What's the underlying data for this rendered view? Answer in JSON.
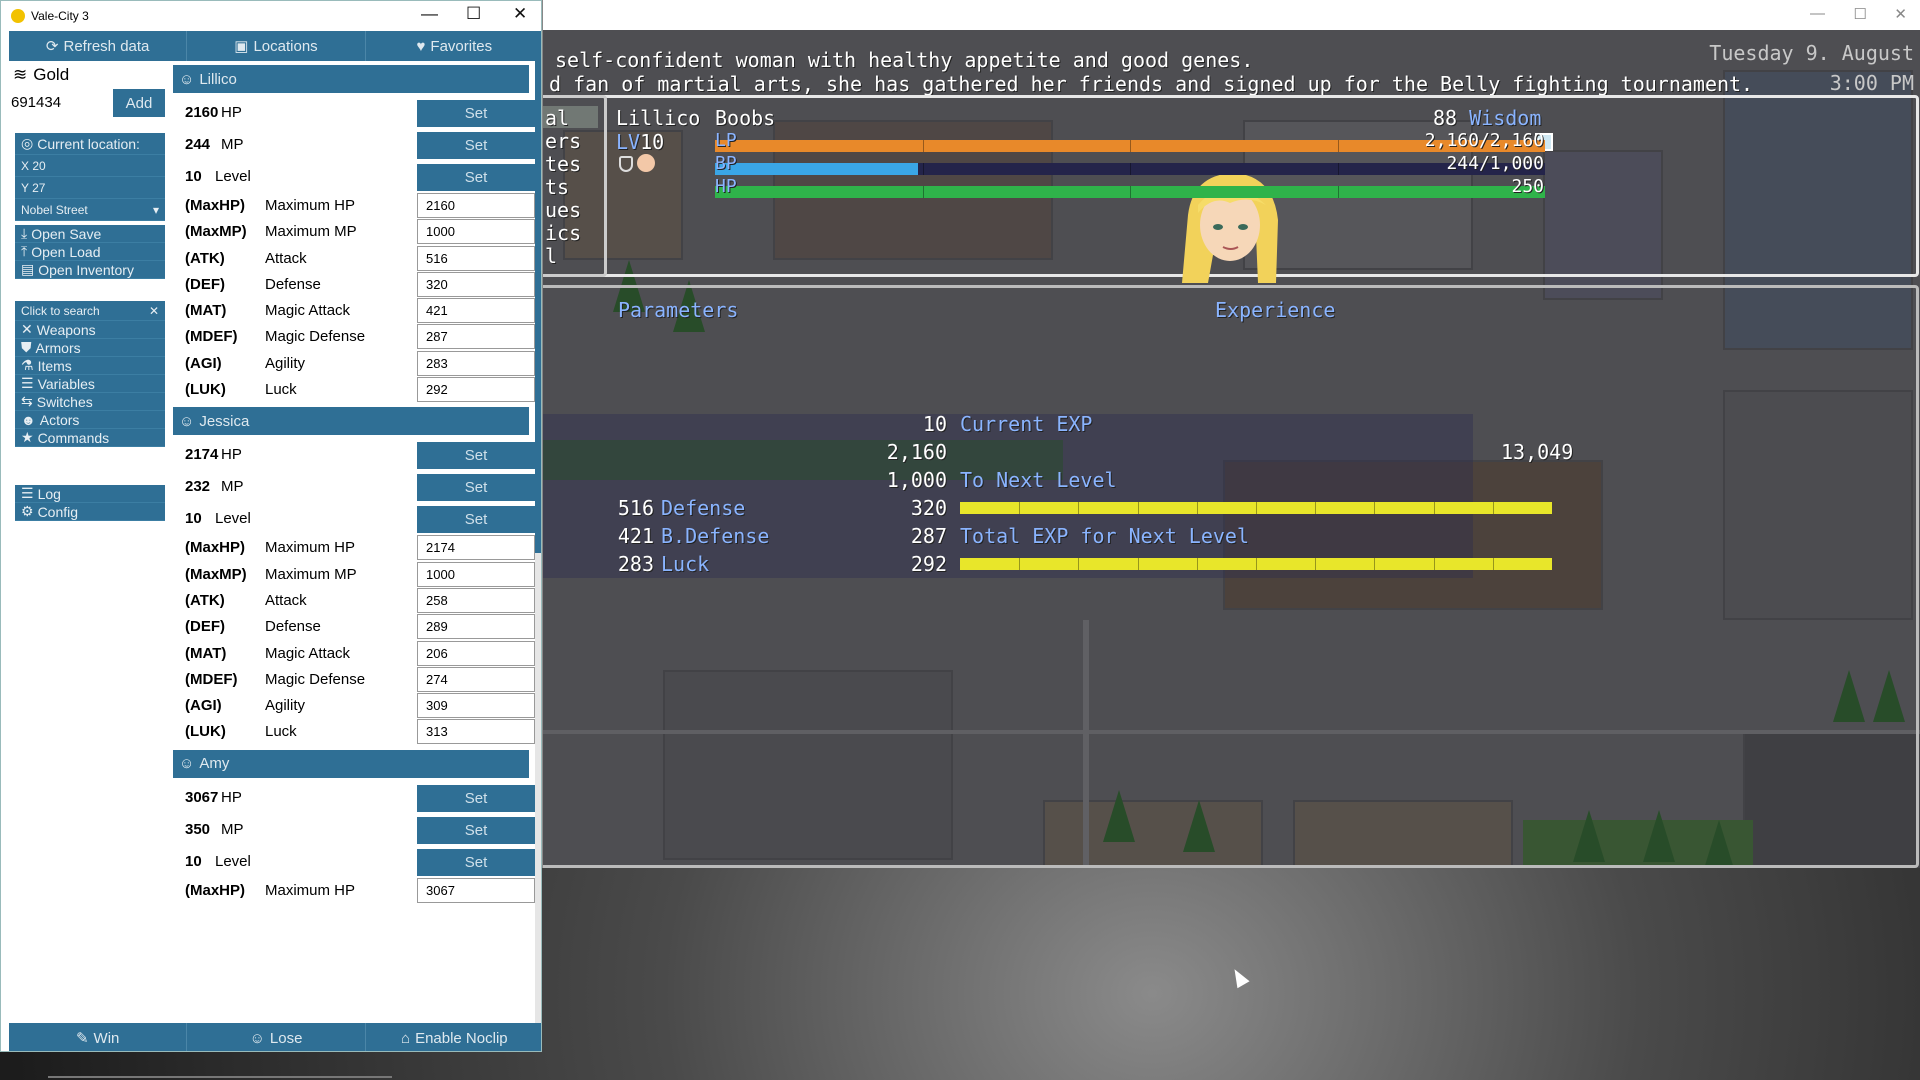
{
  "tool": {
    "title": "Vale-City 3",
    "window_controls": {
      "minimize": "—",
      "maximize": "☐",
      "close": "✕"
    },
    "nav": [
      {
        "label": "Refresh data",
        "icon": "refresh-icon"
      },
      {
        "label": "Locations",
        "icon": "location-icon"
      },
      {
        "label": "Favorites",
        "icon": "heart-icon"
      }
    ],
    "gold": {
      "label": "Gold",
      "value": "691434",
      "add_label": "Add"
    },
    "location": {
      "label": "Current location:",
      "x": "X 20",
      "y": "Y 27",
      "map": "Nobel Street"
    },
    "file_actions": [
      {
        "label": "Open Save",
        "icon": "download-icon"
      },
      {
        "label": "Open Load",
        "icon": "upload-icon"
      },
      {
        "label": "Open Inventory",
        "icon": "inventory-icon"
      }
    ],
    "search": {
      "placeholder": "Click to search",
      "clear": "✕"
    },
    "categories": [
      {
        "label": "Weapons",
        "icon": "swords-icon"
      },
      {
        "label": "Armors",
        "icon": "shield-icon"
      },
      {
        "label": "Items",
        "icon": "flask-icon"
      },
      {
        "label": "Variables",
        "icon": "list-icon"
      },
      {
        "label": "Switches",
        "icon": "toggle-icon"
      },
      {
        "label": "Actors",
        "icon": "users-icon"
      },
      {
        "label": "Commands",
        "icon": "star-icon"
      }
    ],
    "misc": [
      {
        "label": "Log",
        "icon": "list-icon"
      },
      {
        "label": "Config",
        "icon": "gear-icon"
      }
    ],
    "set_label": "Set",
    "actors": [
      {
        "name": "Lillico",
        "hp": "2160",
        "mp": "244",
        "level": "10",
        "params": [
          {
            "code": "(MaxHP)",
            "name": "Maximum HP",
            "value": "2160"
          },
          {
            "code": "(MaxMP)",
            "name": "Maximum MP",
            "value": "1000"
          },
          {
            "code": "(ATK)",
            "name": "Attack",
            "value": "516"
          },
          {
            "code": "(DEF)",
            "name": "Defense",
            "value": "320"
          },
          {
            "code": "(MAT)",
            "name": "Magic Attack",
            "value": "421"
          },
          {
            "code": "(MDEF)",
            "name": "Magic Defense",
            "value": "287"
          },
          {
            "code": "(AGI)",
            "name": "Agility",
            "value": "283"
          },
          {
            "code": "(LUK)",
            "name": "Luck",
            "value": "292"
          }
        ]
      },
      {
        "name": "Jessica",
        "hp": "2174",
        "mp": "232",
        "level": "10",
        "params": [
          {
            "code": "(MaxHP)",
            "name": "Maximum HP",
            "value": "2174"
          },
          {
            "code": "(MaxMP)",
            "name": "Maximum MP",
            "value": "1000"
          },
          {
            "code": "(ATK)",
            "name": "Attack",
            "value": "258"
          },
          {
            "code": "(DEF)",
            "name": "Defense",
            "value": "289"
          },
          {
            "code": "(MAT)",
            "name": "Magic Attack",
            "value": "206"
          },
          {
            "code": "(MDEF)",
            "name": "Magic Defense",
            "value": "274"
          },
          {
            "code": "(AGI)",
            "name": "Agility",
            "value": "309"
          },
          {
            "code": "(LUK)",
            "name": "Luck",
            "value": "313"
          }
        ]
      },
      {
        "name": "Amy",
        "hp": "3067",
        "mp": "350",
        "level": "10",
        "params": [
          {
            "code": "(MaxHP)",
            "name": "Maximum HP",
            "value": "3067"
          }
        ]
      }
    ],
    "unit_labels": {
      "hp": "HP",
      "mp": "MP",
      "level": "Level"
    },
    "bottom": [
      {
        "label": "Win",
        "icon": "wand-icon"
      },
      {
        "label": "Lose",
        "icon": "person-icon"
      },
      {
        "label": "Enable Noclip",
        "icon": "ghost-icon"
      }
    ]
  },
  "game": {
    "window_controls": {
      "minimize": "—",
      "maximize": "☐",
      "close": "✕"
    },
    "description": [
      "self-confident woman with healthy appetite and good genes.",
      "d fan of martial arts, she has gathered her friends and signed up for the Belly fighting tournament."
    ],
    "menu_fragments": [
      "al",
      "ers",
      "tes",
      "ts",
      "ues",
      "ics",
      "l"
    ],
    "date": {
      "day": "Tuesday 9. August",
      "time": "3:00 PM"
    },
    "character": {
      "name": "Lillico",
      "level_label": "LV",
      "level": "10",
      "class": "Boobs",
      "wisdom_value": "88",
      "wisdom_label": "Wisdom"
    },
    "bars": [
      {
        "label": "LP",
        "text": "2,160/2,160",
        "fill": 1.0,
        "color": "#e8892a"
      },
      {
        "label": "BP",
        "text": "244/1,000",
        "fill": 0.244,
        "color": "#3aa6e6"
      },
      {
        "label": "HP",
        "text": "250",
        "fill": 1.0,
        "color": "#2fb34a"
      }
    ],
    "headers": {
      "parameters": "Parameters",
      "experience": "Experience"
    },
    "param_rows": [
      {
        "left_val": "",
        "left_label": "",
        "right_val": "10"
      },
      {
        "left_val": "",
        "left_label": "",
        "right_val": "2,160"
      },
      {
        "left_val": "",
        "left_label": "",
        "right_val": "1,000"
      },
      {
        "left_val": "516",
        "left_label": "Defense",
        "right_val": "320"
      },
      {
        "left_val": "421",
        "left_label": "B.Defense",
        "right_val": "287"
      },
      {
        "left_val": "283",
        "left_label": "Luck",
        "right_val": "292"
      }
    ],
    "exp": {
      "current_label": "Current EXP",
      "current_value": "13,049",
      "next_label": "To Next Level",
      "total_label": "Total EXP for Next Level",
      "next_fill": 1.0,
      "total_fill": 1.0
    }
  }
}
